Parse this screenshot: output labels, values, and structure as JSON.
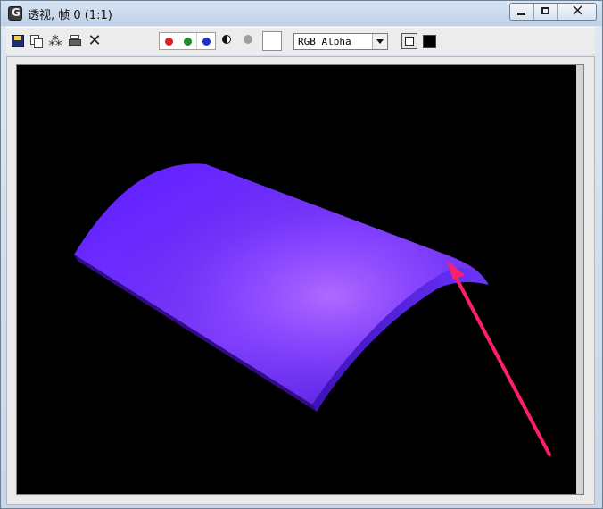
{
  "window": {
    "title": "透视, 帧 0 (1:1)"
  },
  "toolbar": {
    "icons": [
      "save-icon",
      "copy-icon",
      "clone-icon",
      "print-icon",
      "clear-icon"
    ],
    "channel_buttons": [
      {
        "name": "red-channel",
        "color": "#e02020"
      },
      {
        "name": "green-channel",
        "color": "#1c8f2a"
      },
      {
        "name": "blue-channel",
        "color": "#1e32c8"
      }
    ],
    "mono_icon": "monochrome-icon",
    "gray_dot_color": "#9e9e9e",
    "swatch_color": "#ffffff",
    "channel_select_value": "RGB Alpha",
    "black_swatch_color": "#000000"
  },
  "render": {
    "object_color": "#6c2cff",
    "arrow_color": "#ff1f67"
  }
}
